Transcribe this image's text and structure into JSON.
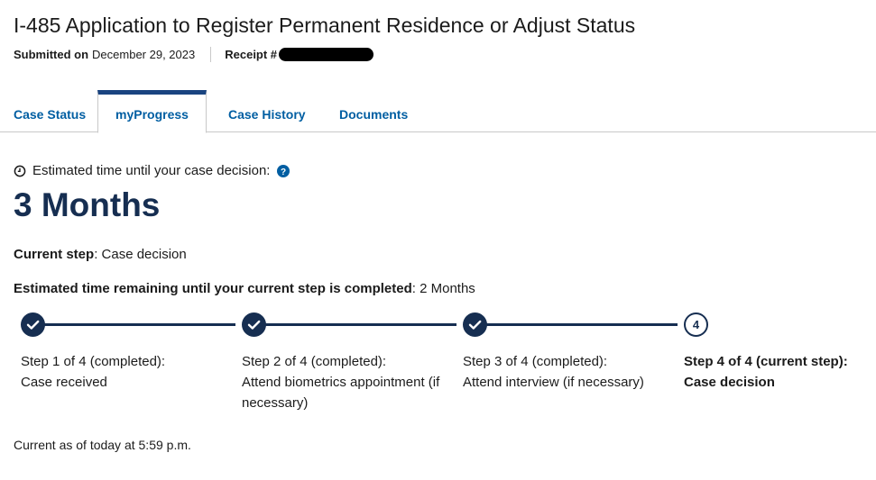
{
  "header": {
    "title": "I-485 Application to Register Permanent Residence or Adjust Status",
    "submitted_label": "Submitted on",
    "submitted_date": "December 29, 2023",
    "receipt_label": "Receipt #"
  },
  "tabs": [
    {
      "label": "Case Status",
      "active": false
    },
    {
      "label": "myProgress",
      "active": true
    },
    {
      "label": "Case History",
      "active": false
    },
    {
      "label": "Documents",
      "active": false
    }
  ],
  "estimate": {
    "label": "Estimated time until your case decision:",
    "value": "3 Months"
  },
  "current_step": {
    "label": "Current step",
    "value": ": Case decision"
  },
  "remaining": {
    "label": "Estimated time remaining until your current step is completed",
    "value": ": 2 Months"
  },
  "steps": [
    {
      "status": "Step 1 of 4 (completed):",
      "name": "Case received"
    },
    {
      "status": "Step 2 of 4 (completed):",
      "name": "Attend biometrics appointment (if necessary)"
    },
    {
      "status": "Step 3 of 4 (completed):",
      "name": "Attend interview (if necessary)"
    },
    {
      "status": "Step 4 of 4 (current step):",
      "name": "Case decision",
      "number": "4"
    }
  ],
  "footer": "Current as of today at 5:59 p.m.",
  "colors": {
    "navy": "#162e51",
    "link": "#005ea2",
    "tab_accent": "#1a4480",
    "help": "#005ea2"
  },
  "icons": {
    "clock": "clock-icon",
    "help": "help-circle-icon",
    "check": "check-icon"
  }
}
